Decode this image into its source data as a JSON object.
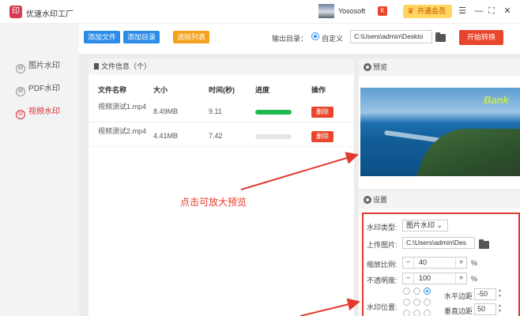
{
  "app": {
    "title": "优速水印工厂",
    "logo_glyph": "印",
    "user_name": "Yososoft",
    "vip_label": "开通会员",
    "window_controls": {
      "menu": "☰",
      "minimize": "—",
      "maximize": "⛶",
      "close": "✕"
    }
  },
  "sidebar": {
    "items": [
      {
        "label": "图片水印",
        "icon": "image-watermark-icon",
        "active": false
      },
      {
        "label": "PDF水印",
        "icon": "pdf-watermark-icon",
        "active": false
      },
      {
        "label": "视频水印",
        "icon": "video-watermark-icon",
        "active": true
      }
    ]
  },
  "toolbar": {
    "add_file": "添加文件",
    "add_dir": "添加目录",
    "clear_list": "清除列表",
    "output_label": "输出目录：",
    "custom_label": "自定义",
    "output_path": "C:\\Users\\admin\\Deskto",
    "start_label": "开始转换"
  },
  "file_panel": {
    "header": "文件信息（个）",
    "columns": [
      "文件名称",
      "大小",
      "时间(秒)",
      "进度",
      "操作"
    ],
    "rows": [
      {
        "name": "视频测试1.mp4",
        "size": "8.49MB",
        "time": "9.11",
        "progress": 1.0,
        "action": "删除"
      },
      {
        "name": "视频测试2.mp4",
        "size": "4.41MB",
        "time": "7.42",
        "progress": 0.0,
        "action": "删除"
      }
    ]
  },
  "hint": "点击可放大预览",
  "preview": {
    "header": "预览",
    "watermark_text": "Bank"
  },
  "settings": {
    "header": "设置",
    "type_label": "水印类型:",
    "type_value": "图片水印",
    "upload_label": "上传图片:",
    "upload_path": "C:\\Users\\admin\\Des",
    "scale_label": "缩放比例:",
    "scale_value": "40",
    "opacity_label": "不透明度:",
    "opacity_value": "100",
    "percent": "%",
    "position_label": "水印位置:",
    "h_margin_label": "水平边距",
    "h_margin_value": "-50",
    "v_margin_label": "垂直边距",
    "v_margin_value": "50",
    "minus": "−",
    "plus": "+"
  },
  "colors": {
    "accent_blue": "#2b8be8",
    "accent_red": "#e8452c",
    "accent_orange": "#f5a01b",
    "progress_green": "#1fb84f",
    "sidebar_bg": "#f2f3f5"
  }
}
